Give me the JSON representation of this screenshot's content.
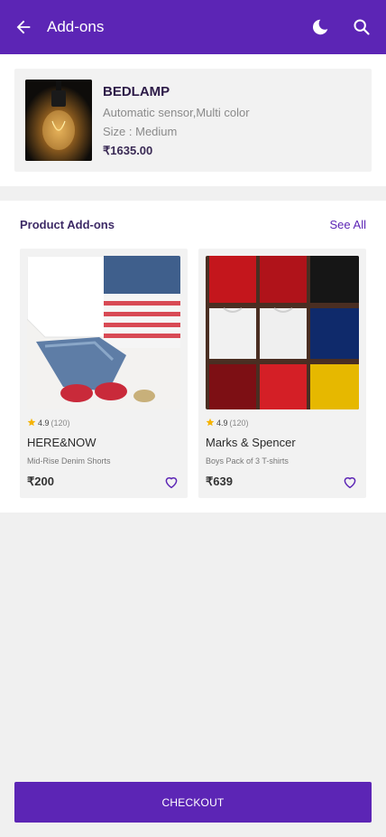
{
  "appbar": {
    "title": "Add-ons",
    "back_icon": "arrow-left-icon",
    "theme_icon": "moon-icon",
    "search_icon": "search-icon"
  },
  "product": {
    "name": "BEDLAMP",
    "description": "Automatic sensor,Multi color",
    "size": "Size : Medium",
    "price": "₹1635.00",
    "image_icon": "bulb-lamp-image"
  },
  "addons": {
    "heading": "Product Add-ons",
    "see_all": "See All",
    "items": [
      {
        "brand": "HERE&NOW",
        "subtitle": "Mid-Rise Denim Shorts",
        "rating": "4.9",
        "reviews": "(120)",
        "price": "₹200",
        "image_icon": "clothing-flatlay-image"
      },
      {
        "brand": "Marks & Spencer",
        "subtitle": "Boys Pack of 3 T-shirts",
        "rating": "4.9",
        "reviews": "(120)",
        "price": "₹639",
        "image_icon": "tshirts-grid-image"
      }
    ]
  },
  "checkout": {
    "label": "CHECKOUT"
  },
  "colors": {
    "primary": "#5c25b5",
    "star": "#f5b301",
    "background": "#f0f0f0"
  }
}
